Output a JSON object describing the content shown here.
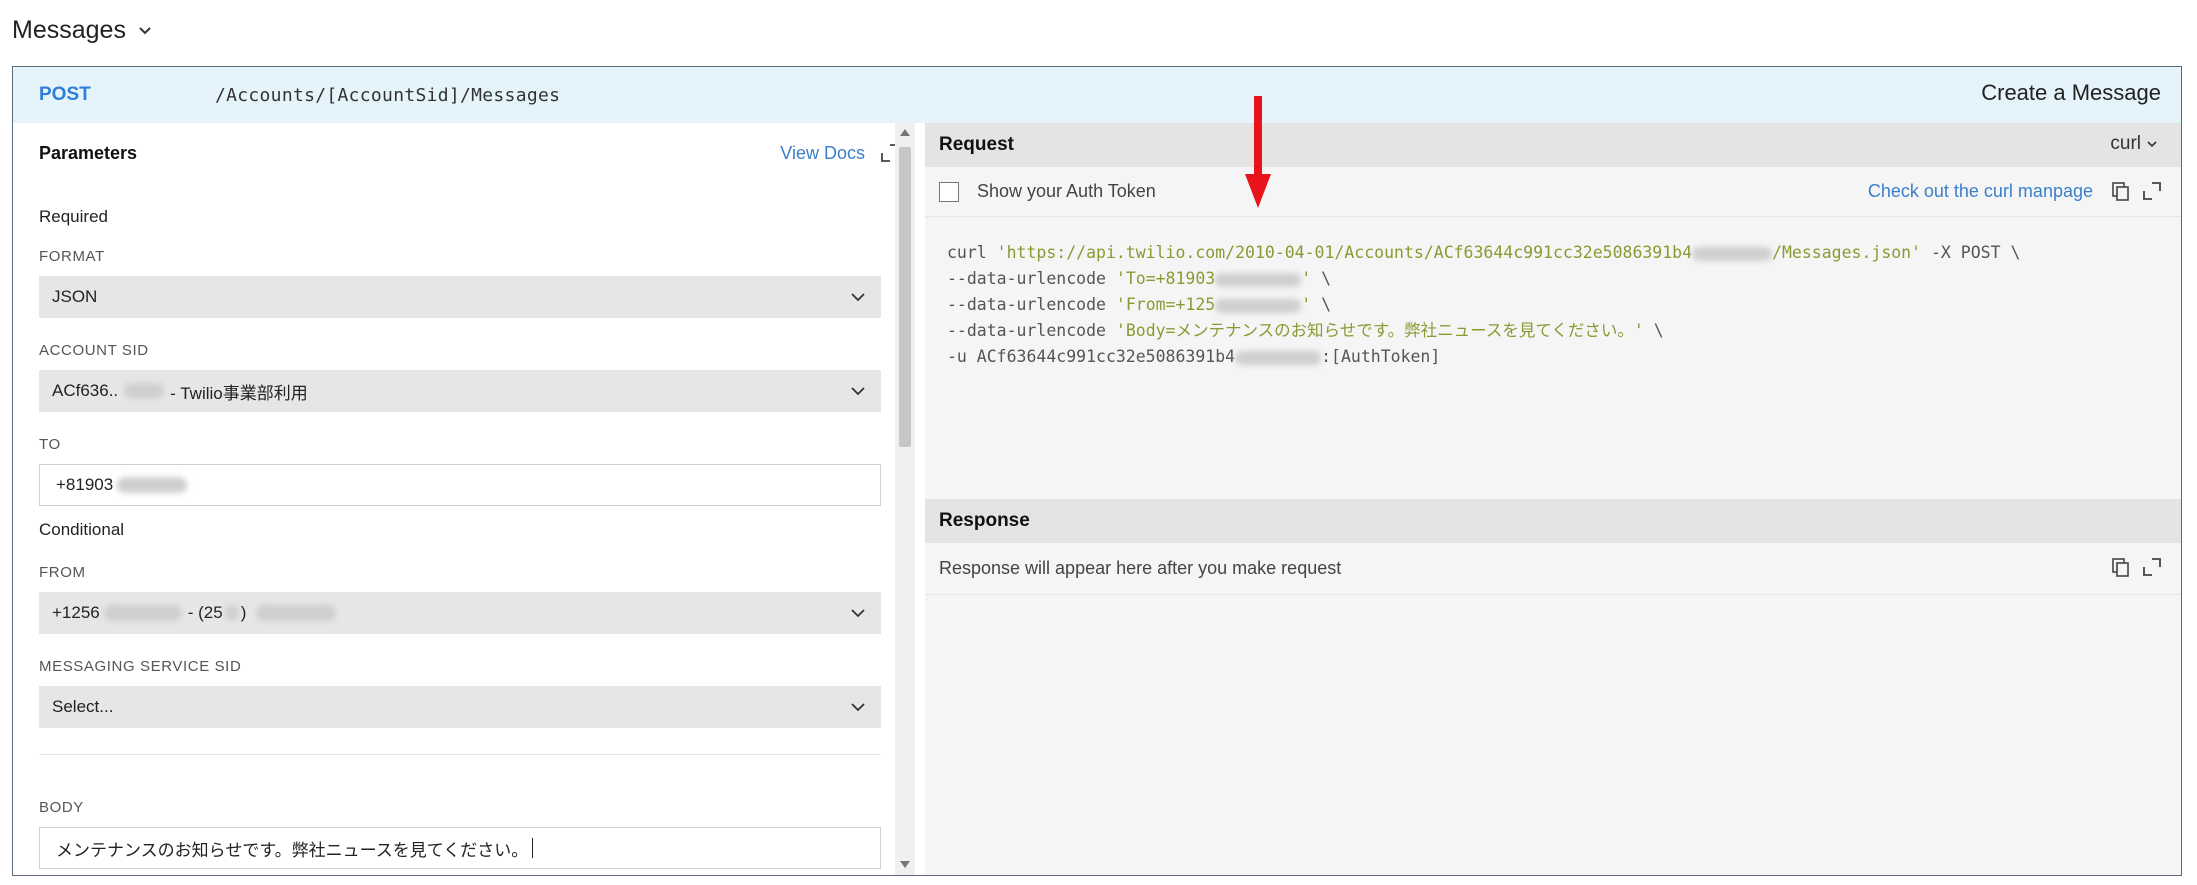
{
  "header": {
    "title": "Messages"
  },
  "endpoint": {
    "method": "POST",
    "path": "/Accounts/[AccountSid]/Messages",
    "operation_title": "Create a Message"
  },
  "params": {
    "title": "Parameters",
    "view_docs": "View Docs",
    "required_label": "Required",
    "conditional_label": "Conditional",
    "format": {
      "label": "FORMAT",
      "value": "JSON"
    },
    "account_sid": {
      "label": "ACCOUNT SID",
      "value_prefix": "ACf636..",
      "value_suffix": "- Twilio事業部利用"
    },
    "to": {
      "label": "TO",
      "value_prefix": "+81903"
    },
    "from": {
      "label": "FROM",
      "value_prefix": "+1256",
      "value_mid": "- (25",
      "value_close": ")"
    },
    "messaging_service_sid": {
      "label": "MESSAGING SERVICE SID",
      "value": "Select..."
    },
    "body": {
      "label": "BODY",
      "value": "メンテナンスのお知らせです。弊社ニュースを見てください。"
    }
  },
  "request": {
    "title": "Request",
    "language": "curl",
    "auth_token_label": "Show your Auth Token",
    "curl_manpage_link": "Check out the curl manpage",
    "code": {
      "l1_cmd": "curl ",
      "l1_url_a": "'https://api.twilio.com/2010-04-01/Accounts/ACf63644c991cc32e5086391b4",
      "l1_url_b": "/Messages.json'",
      "l1_rest": " -X POST \\",
      "l2_flag": "--data-urlencode ",
      "l2_str_a": "'To=+81903",
      "l2_str_b": "'",
      "l2_rest": " \\",
      "l3_flag": "--data-urlencode ",
      "l3_str_a": "'From=+125",
      "l3_str_b": "'",
      "l3_rest": " \\",
      "l4_flag": "--data-urlencode ",
      "l4_str": "'Body=メンテナンスのお知らせです。弊社ニュースを見てください。'",
      "l4_rest": " \\",
      "l5_a": "-u ACf63644c991cc32e5086391b4",
      "l5_b": ":[AuthToken]"
    }
  },
  "response": {
    "title": "Response",
    "placeholder": "Response will appear here after you make request"
  },
  "colors": {
    "endpoint_bar": "#e5f3fb",
    "method": "#2f7fd8",
    "link": "#3b7fc9",
    "code_string": "#8a9a33",
    "annotation_arrow": "#e8141c"
  }
}
